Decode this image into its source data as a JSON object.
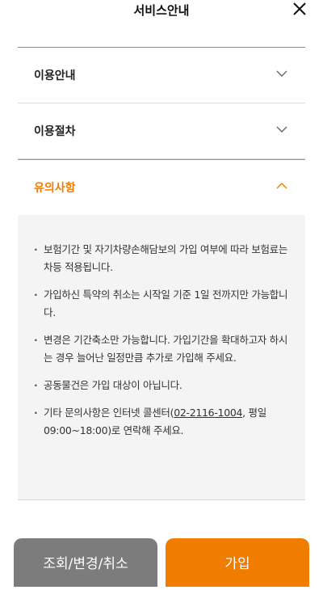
{
  "header": {
    "title": "서비스안내"
  },
  "accordion": [
    {
      "label": "이용안내",
      "expanded": false
    },
    {
      "label": "이용절차",
      "expanded": false
    },
    {
      "label": "유의사항",
      "expanded": true
    }
  ],
  "notice": {
    "item1": "보험기간 및 자기차량손해담보의 가입 여부에 따라 보험료는 차등 적용됩니다.",
    "item2": "가입하신 특약의 취소는 시작일 기준 1일 전까지만 가능합니다.",
    "item3": "변경은 기간축소만 가능합니다. 가입기간을 확대하고자 하시는 경우 늘어난 일정만큼 추가로 가입해 주세요.",
    "item4": "공동물건은 가입 대상이 아닙니다.",
    "item5_pre": "기타 문의사항은 인터넷 콜센터(",
    "item5_phone": "02-2116-1004",
    "item5_post": ", 평일 09:00~18:00)로 연락해 주세요."
  },
  "buttons": {
    "secondary": "조회/변경/취소",
    "primary": "가입"
  },
  "colors": {
    "accent": "#f07c00",
    "secondary_button": "#7c7c7c",
    "panel_bg": "#f4f4f4"
  }
}
